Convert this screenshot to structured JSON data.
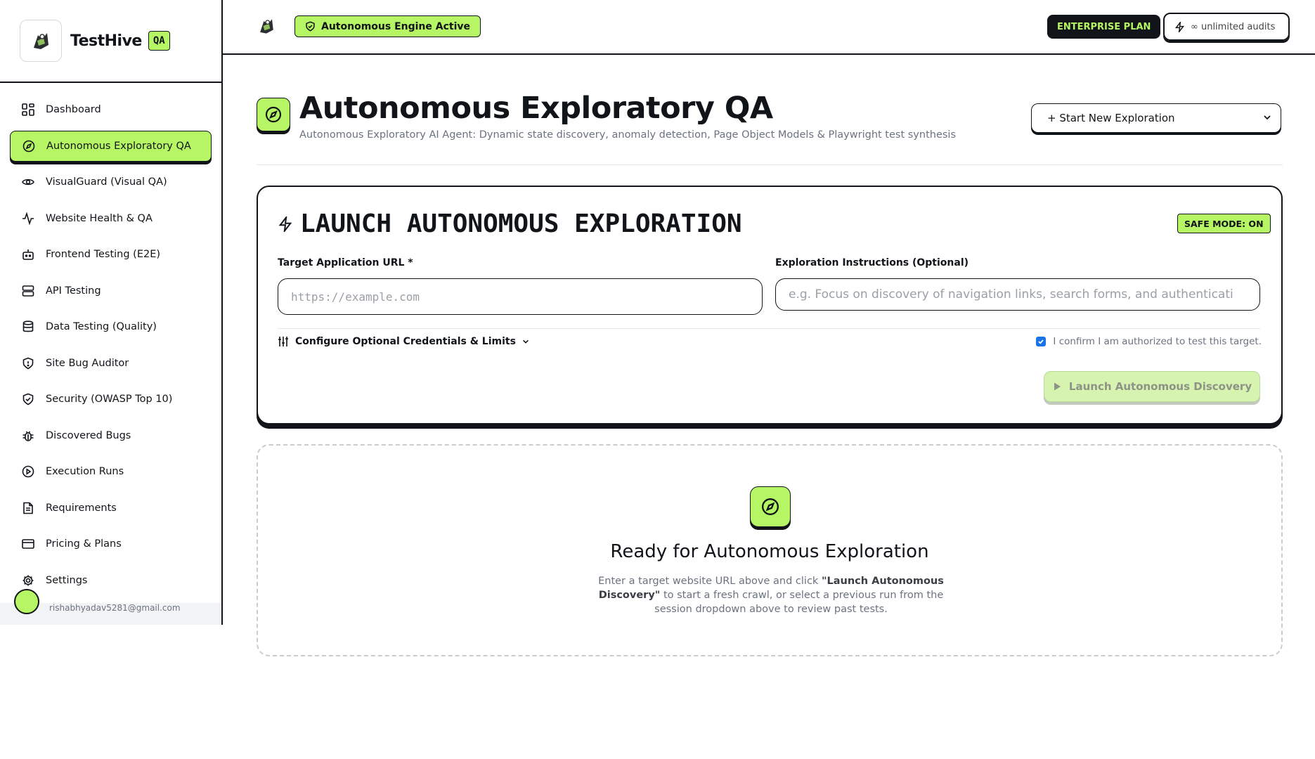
{
  "brand": {
    "name": "TestHive",
    "badge": "QA"
  },
  "sidebar": {
    "items": [
      {
        "label": "Dashboard",
        "icon": "grid-icon"
      },
      {
        "label": "Autonomous Exploratory QA",
        "icon": "compass-icon",
        "active": true
      },
      {
        "label": "VisualGuard (Visual QA)",
        "icon": "eye-icon"
      },
      {
        "label": "Website Health & QA",
        "icon": "activity-icon"
      },
      {
        "label": "Frontend Testing (E2E)",
        "icon": "bot-icon"
      },
      {
        "label": "API Testing",
        "icon": "server-icon"
      },
      {
        "label": "Data Testing (Quality)",
        "icon": "database-icon"
      },
      {
        "label": "Site Bug Auditor",
        "icon": "shield-alert-icon"
      },
      {
        "label": "Security (OWASP Top 10)",
        "icon": "shield-check-icon"
      },
      {
        "label": "Discovered Bugs",
        "icon": "bug-icon"
      },
      {
        "label": "Execution Runs",
        "icon": "play-circle-icon"
      },
      {
        "label": "Requirements",
        "icon": "file-text-icon"
      },
      {
        "label": "Pricing & Plans",
        "icon": "credit-card-icon"
      },
      {
        "label": "Settings",
        "icon": "settings-icon"
      }
    ],
    "user_email": "rishabhyadav5281@gmail.com"
  },
  "topbar": {
    "engine_status": "Autonomous Engine Active",
    "plan": "ENTERPRISE PLAN",
    "audits": "∞ unlimited audits"
  },
  "header": {
    "title": "Autonomous Exploratory QA",
    "subtitle": "Autonomous Exploratory AI Agent: Dynamic state discovery, anomaly detection, Page Object Models & Playwright test synthesis",
    "session_select": "+ Start New Exploration"
  },
  "launch": {
    "title": "LAUNCH AUTONOMOUS EXPLORATION",
    "safe_mode": "SAFE MODE: ON",
    "url_label": "Target Application URL *",
    "url_placeholder": "https://example.com",
    "instructions_label": "Exploration Instructions (Optional)",
    "instructions_placeholder": "e.g. Focus on discovery of navigation links, search forms, and authenticati",
    "config_label": "Configure Optional Credentials & Limits",
    "confirm_label": "I confirm I am authorized to test this target.",
    "confirm_checked": true,
    "button": "Launch Autonomous Discovery"
  },
  "empty_state": {
    "title": "Ready for Autonomous Exploration",
    "desc_pre": "Enter a target website URL above and click ",
    "desc_bold": "\"Launch Autonomous Discovery\"",
    "desc_post": " to start a fresh crawl, or select a previous run from the session dropdown above to review past tests."
  },
  "colors": {
    "accent": "#b6f563",
    "ink": "#111418",
    "muted": "#6b7280"
  }
}
